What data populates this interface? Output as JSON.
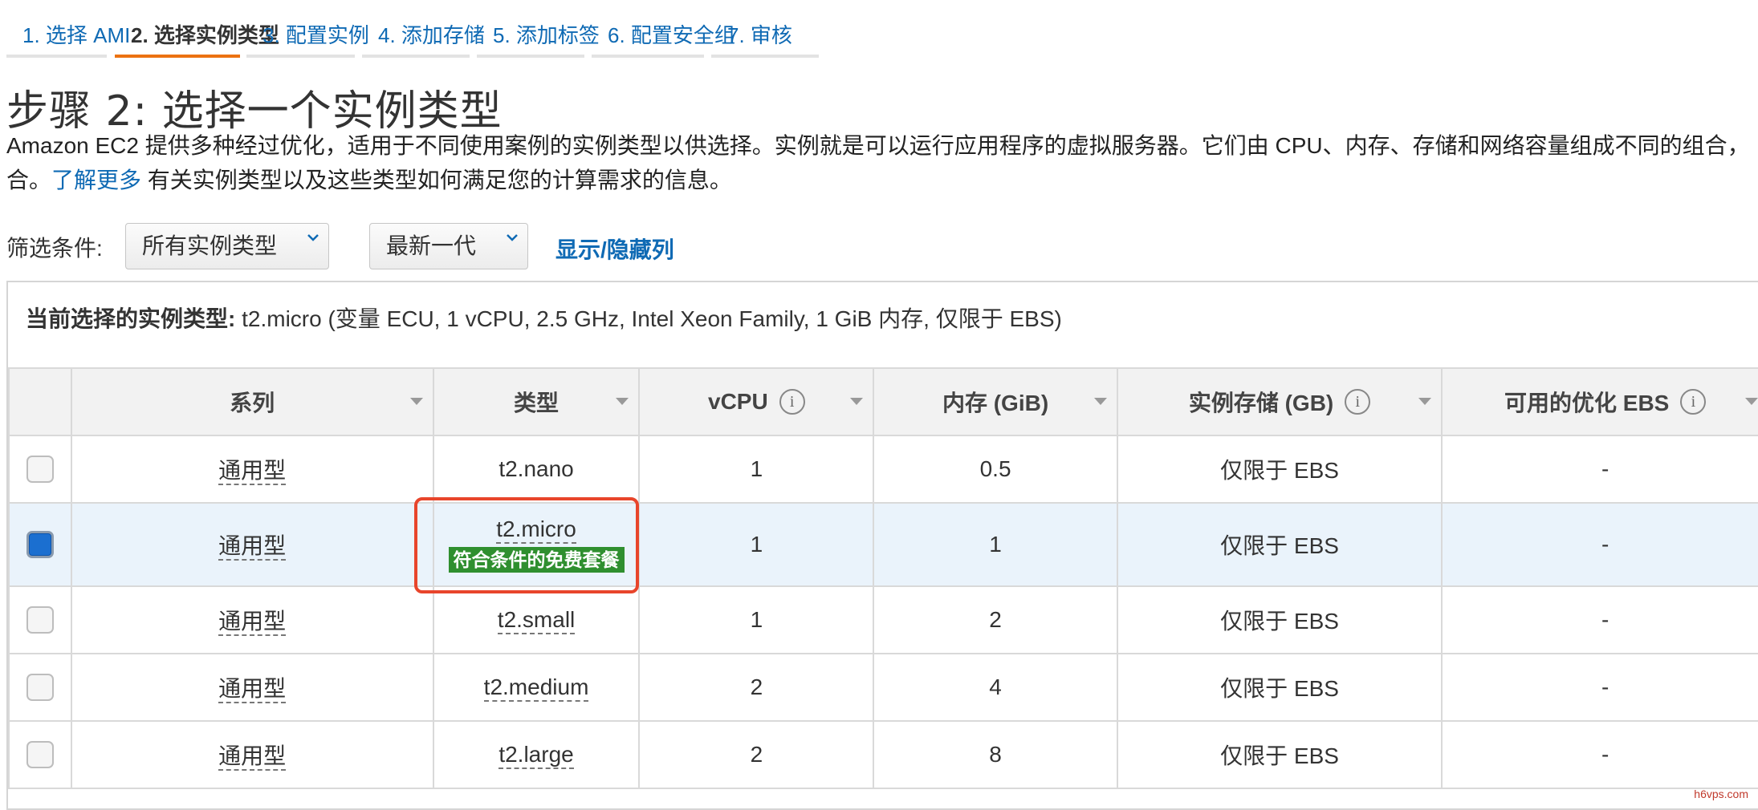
{
  "wizard": {
    "tabs": [
      {
        "label": "1. 选择 AMI"
      },
      {
        "label": "2. 选择实例类型"
      },
      {
        "label": "3. 配置实例"
      },
      {
        "label": "4. 添加存储"
      },
      {
        "label": "5. 添加标签"
      },
      {
        "label": "6. 配置安全组"
      },
      {
        "label": "7. 审核"
      }
    ],
    "active_index": 1
  },
  "page": {
    "title": "步骤 2: 选择一个实例类型",
    "description_line1": "Amazon EC2 提供多种经过优化，适用于不同使用案例的实例类型以供选择。实例就是可以运行应用程序的虚拟服务器。它们由 CPU、内存、存储和网络容量组成不同的组合，可",
    "description_line2_prefix": "合。",
    "learn_more": "了解更多",
    "description_line2_suffix": " 有关实例类型以及这些类型如何满足您的计算需求的信息。"
  },
  "filter": {
    "label": "筛选条件:",
    "type_dropdown": "所有实例类型",
    "generation_dropdown": "最新一代",
    "toggle_columns": "显示/隐藏列"
  },
  "selection": {
    "label": "当前选择的实例类型:",
    "value": " t2.micro (变量 ECU, 1 vCPU, 2.5 GHz, Intel Xeon Family, 1 GiB 内存, 仅限于 EBS)"
  },
  "table": {
    "headers": [
      "系列",
      "类型",
      "vCPU",
      "内存 (GiB)",
      "实例存储 (GB)",
      "可用的优化 EBS"
    ],
    "info_icon_glyph": "i",
    "free_tier_badge": "符合条件的免费套餐",
    "rows": [
      {
        "family": "通用型",
        "type": "t2.nano",
        "vcpu": "1",
        "memory": "0.5",
        "storage": "仅限于 EBS",
        "ebs": "-",
        "checked": false
      },
      {
        "family": "通用型",
        "type": "t2.micro",
        "vcpu": "1",
        "memory": "1",
        "storage": "仅限于 EBS",
        "ebs": "-",
        "checked": true
      },
      {
        "family": "通用型",
        "type": "t2.small",
        "vcpu": "1",
        "memory": "2",
        "storage": "仅限于 EBS",
        "ebs": "-",
        "checked": false
      },
      {
        "family": "通用型",
        "type": "t2.medium",
        "vcpu": "2",
        "memory": "4",
        "storage": "仅限于 EBS",
        "ebs": "-",
        "checked": false
      },
      {
        "family": "通用型",
        "type": "t2.large",
        "vcpu": "2",
        "memory": "8",
        "storage": "仅限于 EBS",
        "ebs": "-",
        "checked": false
      }
    ]
  },
  "watermark": "h6vps.com",
  "colors": {
    "link": "#0f6ab4",
    "active_tab_underline": "#ec7211",
    "free_tier_badge": "#2f8f2f",
    "highlight_box": "#e8452b",
    "selected_row": "#eaf3fb"
  }
}
